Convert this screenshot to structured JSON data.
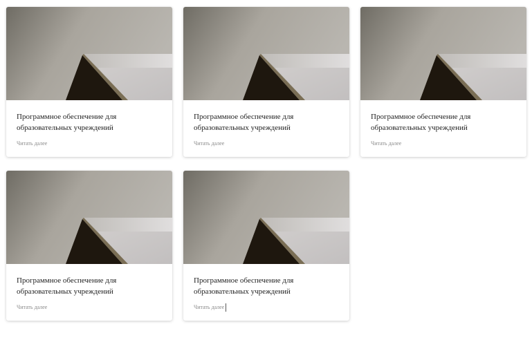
{
  "cards": [
    {
      "title": "Программное обеспечение для образовательных учреждений",
      "link": "Читать далее"
    },
    {
      "title": "Программное обеспечение для образовательных учреждений",
      "link": "Читать далее"
    },
    {
      "title": "Программное обеспечение для образовательных учреждений",
      "link": "Читать далее"
    },
    {
      "title": "Программное обеспечение для образовательных учреждений",
      "link": "Читать далее"
    },
    {
      "title": "Программное обеспечение для образовательных учреждений",
      "link": "Читать далее"
    }
  ],
  "colors": {
    "wall_light": "#b2aea6",
    "wall_dark": "#6f6c64",
    "shadow_triangle": "#1e170e",
    "trim": "#7a6e55",
    "floor": "#c8c5c5"
  }
}
